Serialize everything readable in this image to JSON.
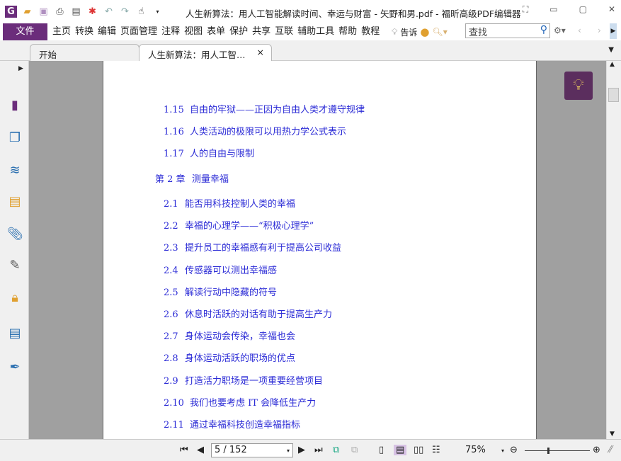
{
  "window": {
    "title": "人生新算法：用人工智能解读时间、幸运与财富 - 矢野和男.pdf - 福昕高级PDF编辑器"
  },
  "menubar": {
    "file": "文件",
    "items": [
      "主页",
      "转换",
      "编辑",
      "页面管理",
      "注释",
      "视图",
      "表单",
      "保护",
      "共享",
      "互联",
      "辅助工具",
      "帮助",
      "教程"
    ],
    "tell_me": "告诉",
    "search_placeholder": "查找"
  },
  "tabs": [
    {
      "label": "开始"
    },
    {
      "label": "人生新算法：用人工智…",
      "close": "×"
    }
  ],
  "toc": [
    {
      "num": "1.15",
      "text": "自由的牢狱——正因为自由人类才遵守规律",
      "level": 2
    },
    {
      "num": "1.16",
      "text": "人类活动的极限可以用热力学公式表示",
      "level": 2
    },
    {
      "num": "1.17",
      "text": "人的自由与限制",
      "level": 2
    },
    {
      "num": "第 2 章",
      "text": "测量幸福",
      "level": 1
    },
    {
      "num": "2.1",
      "text": "能否用科技控制人类的幸福",
      "level": 2
    },
    {
      "num": "2.2",
      "text": "幸福的心理学——“积极心理学”",
      "level": 2
    },
    {
      "num": "2.3",
      "text": "提升员工的幸福感有利于提高公司收益",
      "level": 2
    },
    {
      "num": "2.4",
      "text": "传感器可以测出幸福感",
      "level": 2
    },
    {
      "num": "2.5",
      "text": "解读行动中隐藏的符号",
      "level": 2
    },
    {
      "num": "2.6",
      "text": "休息时活跃的对话有助于提高生产力",
      "level": 2
    },
    {
      "num": "2.7",
      "text": "身体运动会传染，幸福也会",
      "level": 2
    },
    {
      "num": "2.8",
      "text": "身体运动活跃的职场的优点",
      "level": 2
    },
    {
      "num": "2.9",
      "text": "打造活力职场是一项重要经营项目",
      "level": 2
    },
    {
      "num": "2.10",
      "text": "我们也要考虑 IT 会降低生产力",
      "level": 2
    },
    {
      "num": "2.11",
      "text": "通过幸福科技创造幸福指标",
      "level": 2
    }
  ],
  "status": {
    "page": "5 / 152",
    "current_page": 5,
    "total_pages": 152,
    "zoom": "75%"
  },
  "colors": {
    "brand": "#6b2d7b",
    "link": "#2b2bd6"
  }
}
